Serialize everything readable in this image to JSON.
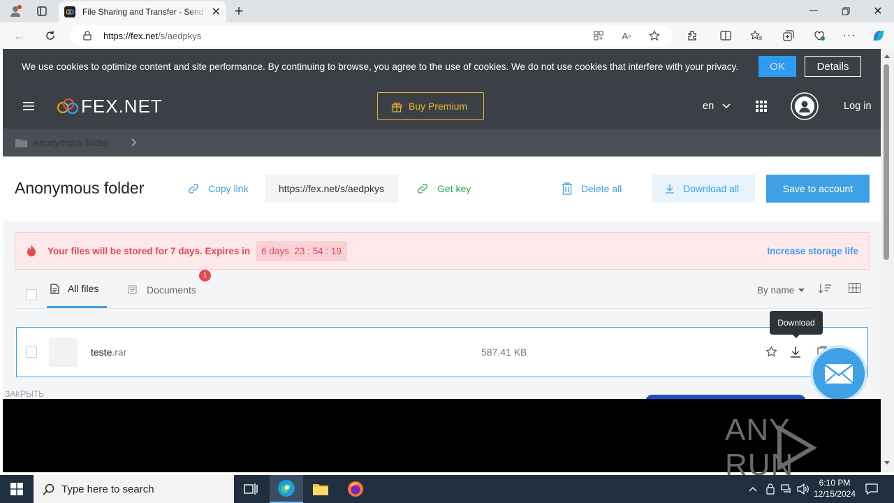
{
  "browser": {
    "tab_title": "File Sharing and Transfer - Send L",
    "url_domain": "https://fex.net",
    "url_path": "/s/aedpkys"
  },
  "cookie_bar": {
    "text": "We use cookies to optimize content and site performance. By continuing to browse, you agree to the use of cookies. We do not use cookies that interfere with your privacy.",
    "ok_label": "OK",
    "details_label": "Details"
  },
  "header": {
    "logo_text": "FEX.NET",
    "buy_premium": "Buy Premium",
    "language": "en",
    "login": "Log in"
  },
  "breadcrumb": {
    "folder": "Anonymous folder"
  },
  "title_row": {
    "title": "Anonymous folder",
    "copy_link": "Copy link",
    "link_value": "https://fex.net/s/aedpkys",
    "get_key": "Get key",
    "delete_all": "Delete all",
    "download_all": "Download all",
    "save_to_account": "Save to account"
  },
  "expiry": {
    "message": "Your files will be stored for 7 days. Expires in",
    "countdown": "6 days  23 : 54 : 19",
    "increase": "Increase storage life"
  },
  "tabs": {
    "all_files": "All files",
    "documents": "Documents",
    "documents_badge": "1",
    "sort": "By name"
  },
  "files": [
    {
      "name": "teste",
      "ext": ".rar",
      "size": "587.41 KB"
    }
  ],
  "tooltip": "Download",
  "close_text": "ЗАКРЫТЬ",
  "watermark": "ANY RUN",
  "taskbar": {
    "search_placeholder": "Type here to search",
    "time": "6:10 PM",
    "date": "12/15/2024"
  },
  "colors": {
    "accent": "#3fa0e6",
    "header_bg": "#3b4047",
    "premium": "#f0b429",
    "alert_red": "#e8474f"
  }
}
